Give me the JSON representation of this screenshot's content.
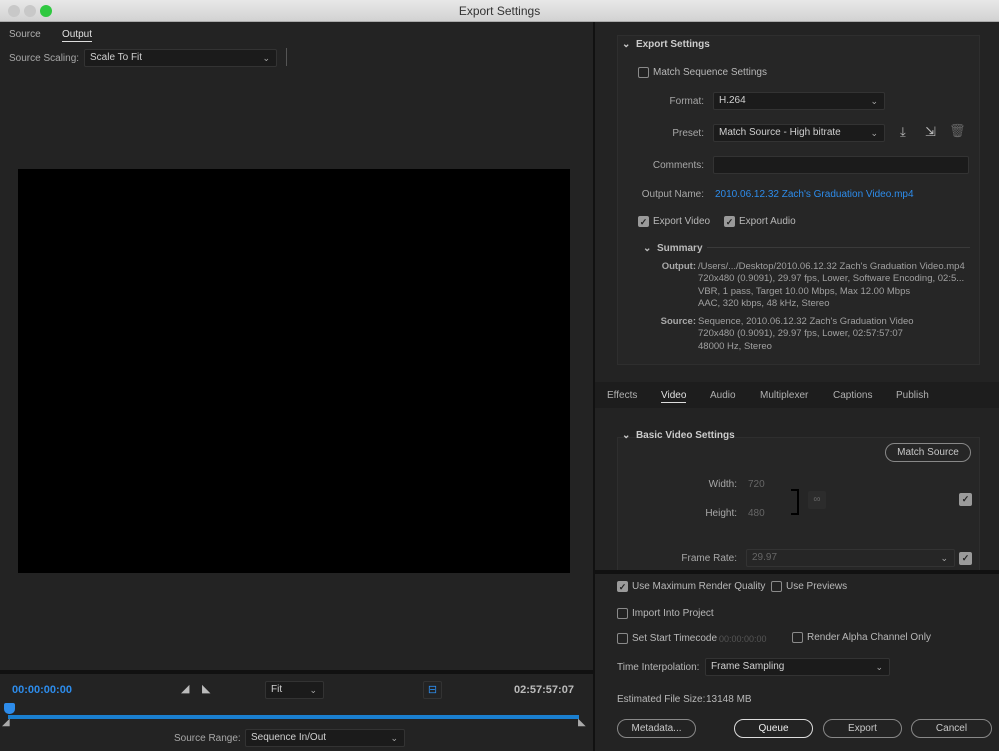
{
  "window": {
    "title": "Export Settings"
  },
  "left": {
    "tabs": [
      "Source",
      "Output"
    ],
    "source_scaling_label": "Source Scaling:",
    "source_scaling_value": "Scale To Fit",
    "current_time": "00:00:00:00",
    "duration": "02:57:57:07",
    "zoom_value": "Fit",
    "source_range_label": "Source Range:",
    "source_range_value": "Sequence In/Out",
    "accent": "#2d8ceb"
  },
  "export_settings": {
    "header": "Export Settings",
    "match_sequence": "Match Sequence Settings",
    "format_label": "Format:",
    "format_value": "H.264",
    "preset_label": "Preset:",
    "preset_value": "Match Source - High bitrate",
    "comments_label": "Comments:",
    "comments_value": "",
    "output_name_label": "Output Name:",
    "output_name_value": "2010.06.12.32 Zach's Graduation Video.mp4",
    "export_video": "Export Video",
    "export_audio": "Export Audio",
    "summary_header": "Summary",
    "output_label": "Output:",
    "output_lines": [
      "/Users/.../Desktop/2010.06.12.32 Zach's Graduation Video.mp4",
      "720x480 (0.9091), 29.97 fps, Lower, Software Encoding, 02:5...",
      "VBR, 1 pass, Target 10.00 Mbps, Max 12.00 Mbps",
      "AAC, 320 kbps, 48 kHz, Stereo"
    ],
    "source_label": "Source:",
    "source_lines": [
      "Sequence, 2010.06.12.32 Zach's Graduation Video",
      "720x480 (0.9091), 29.97 fps, Lower, 02:57:57:07",
      "48000 Hz, Stereo"
    ]
  },
  "settings_tabs": [
    "Effects",
    "Video",
    "Audio",
    "Multiplexer",
    "Captions",
    "Publish"
  ],
  "video": {
    "header": "Basic Video Settings",
    "match_source": "Match Source",
    "width_label": "Width:",
    "width_value": "720",
    "height_label": "Height:",
    "height_value": "480",
    "frame_rate_label": "Frame Rate:",
    "frame_rate_value": "29.97"
  },
  "bottom": {
    "max_render": "Use Maximum Render Quality",
    "use_previews": "Use Previews",
    "import_project": "Import Into Project",
    "set_start_tc": "Set Start Timecode",
    "start_tc_value": "00:00:00:00",
    "render_alpha": "Render Alpha Channel Only",
    "time_interp_label": "Time Interpolation:",
    "time_interp_value": "Frame Sampling",
    "file_size_label": "Estimated File Size:",
    "file_size_value": "13148 MB",
    "metadata": "Metadata...",
    "queue": "Queue",
    "export": "Export",
    "cancel": "Cancel"
  }
}
